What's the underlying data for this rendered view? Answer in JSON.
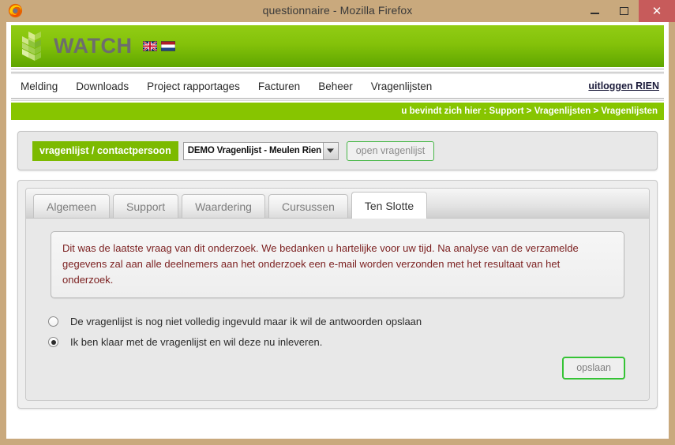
{
  "window": {
    "title": "questionnaire - Mozilla Firefox",
    "firefox_icon": "firefox-icon",
    "minimize_label": "",
    "maximize_label": "",
    "close_label": "✕"
  },
  "site": {
    "brand": "WATCH",
    "logo_icon": "watch-logo-icon",
    "flags": [
      {
        "name": "flag-uk",
        "title": "English"
      },
      {
        "name": "flag-nl",
        "title": "Nederlands"
      }
    ]
  },
  "nav": {
    "items": [
      {
        "label": "Melding",
        "name": "nav-melding"
      },
      {
        "label": "Downloads",
        "name": "nav-downloads"
      },
      {
        "label": "Project rapportages",
        "name": "nav-project-rapportages"
      },
      {
        "label": "Facturen",
        "name": "nav-facturen"
      },
      {
        "label": "Beheer",
        "name": "nav-beheer"
      },
      {
        "label": "Vragenlijsten",
        "name": "nav-vragenlijsten"
      }
    ],
    "logout": "uitloggen RIEN"
  },
  "breadcrumb": {
    "text": "u bevindt zich hier : Support > Vragenlijsten > Vragenlijsten"
  },
  "selector": {
    "tag_label": "vragenlijst / contactpersoon",
    "selected_value": "DEMO Vragenlijst - Meulen Rien",
    "arrow_icon": "chevron-down-icon",
    "open_button": "open vragenlijst"
  },
  "tabs": [
    {
      "label": "Algemeen",
      "name": "tab-algemeen",
      "active": false
    },
    {
      "label": "Support",
      "name": "tab-support",
      "active": false
    },
    {
      "label": "Waardering",
      "name": "tab-waardering",
      "active": false
    },
    {
      "label": "Cursussen",
      "name": "tab-cursussen",
      "active": false
    },
    {
      "label": "Ten Slotte",
      "name": "tab-ten-slotte",
      "active": true
    }
  ],
  "content": {
    "notice": "Dit was de laatste vraag van dit onderzoek. We bedanken u hartelijke voor uw tijd. Na analyse van de verzamelde gegevens zal aan alle deelnemers aan het onderzoek een e-mail worden verzonden met het resultaat van het onderzoek.",
    "options": [
      {
        "label": "De vragenlijst is nog niet volledig ingevuld maar ik wil de antwoorden opslaan",
        "selected": false
      },
      {
        "label": "Ik ben klaar met de vragenlijst en wil deze nu inleveren.",
        "selected": true
      }
    ],
    "save_button": "opslaan"
  },
  "colors": {
    "frame": "#c9a97d",
    "header_green_top": "#91cc14",
    "header_green_bottom": "#5fa600",
    "breadcrumb_green": "#87c500",
    "tag_green": "#7cba00",
    "button_green_border": "#35c335",
    "notice_text": "#7b1f1f",
    "close_red": "#c75b5b"
  }
}
